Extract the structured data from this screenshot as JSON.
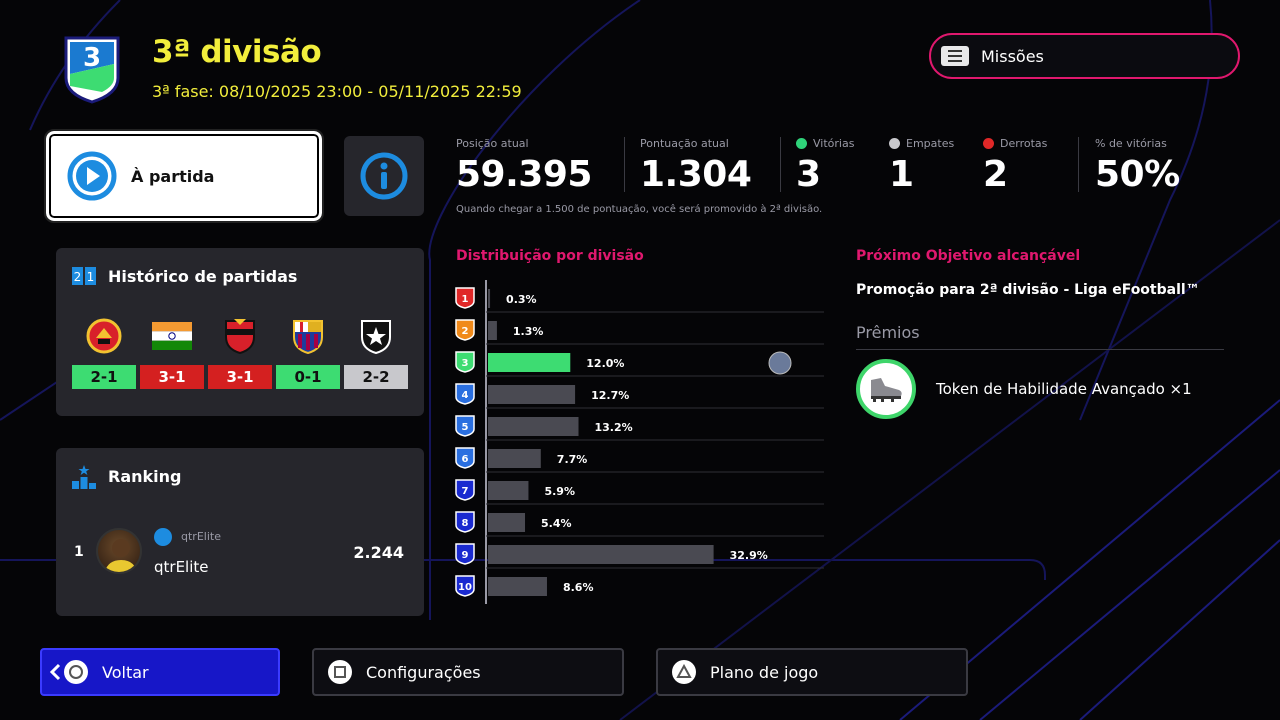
{
  "header": {
    "league_logo_text": "EFOOTBALL LEAGUE",
    "league_logo_number": "3",
    "title": "3ª divisão",
    "phase_dates": "3ª fase: 08/10/2025 23:00 - 05/11/2025 22:59",
    "missions_label": "Missões"
  },
  "match_button": {
    "label": "À partida"
  },
  "stats": {
    "position": {
      "label": "Posição atual",
      "value": "59.395"
    },
    "points": {
      "label": "Pontuação atual",
      "value": "1.304"
    },
    "wins": {
      "label": "Vitórias",
      "value": "3",
      "color": "#2fd37a"
    },
    "draws": {
      "label": "Empates",
      "value": "1",
      "color": "#c8c8cc"
    },
    "losses": {
      "label": "Derrotas",
      "value": "2",
      "color": "#e02828"
    },
    "win_pct": {
      "label": "% de vitórias",
      "value": "50%"
    },
    "note": "Quando chegar a 1.500 de pontuação, você será promovido à 2ª divisão."
  },
  "history": {
    "title": "Histórico de partidas",
    "matches": [
      {
        "opponent_icon": "manchester-united-crest-icon",
        "score": "2-1",
        "result": "win"
      },
      {
        "opponent_icon": "india-flag-icon",
        "score": "3-1",
        "result": "loss"
      },
      {
        "opponent_icon": "sport-recife-crest-icon",
        "score": "3-1",
        "result": "loss"
      },
      {
        "opponent_icon": "barcelona-crest-icon",
        "score": "0-1",
        "result": "win"
      },
      {
        "opponent_icon": "botafogo-crest-icon",
        "score": "2-2",
        "result": "draw"
      }
    ],
    "result_colors": {
      "win": "#3ddc72",
      "loss": "#d42020",
      "draw": "#c8c8cc"
    }
  },
  "ranking": {
    "title": "Ranking",
    "entries": [
      {
        "position": "1",
        "platform_name": "qtrElite",
        "name": "qtrElite",
        "points": "2.244"
      }
    ]
  },
  "distribution": {
    "title": "Distribuição por divisão",
    "current_division": "3"
  },
  "chart_data": {
    "type": "bar",
    "title": "Distribuição por divisão",
    "categories": [
      "1",
      "2",
      "3",
      "4",
      "5",
      "6",
      "7",
      "8",
      "9",
      "10"
    ],
    "values": [
      0.3,
      1.3,
      12.0,
      12.7,
      13.2,
      7.7,
      5.9,
      5.4,
      32.9,
      8.6
    ],
    "value_labels": [
      "0.3%",
      "1.3%",
      "12.0%",
      "12.7%",
      "13.2%",
      "7.7%",
      "5.9%",
      "5.4%",
      "32.9%",
      "8.6%"
    ],
    "badge_colors": [
      "#e02828",
      "#f08a1a",
      "#3ddc72",
      "#2a6fe0",
      "#2a6fe0",
      "#2a6fe0",
      "#1a2ad0",
      "#1a2ad0",
      "#1a2ad0",
      "#1a2ad0"
    ],
    "highlight_index": 2,
    "highlight_color": "#3ddc72",
    "bar_color": "#4a4a52",
    "orientation": "horizontal",
    "xlim": [
      0,
      35
    ]
  },
  "objective": {
    "title": "Próximo Objetivo alcançável",
    "text": "Promoção para 2ª divisão - Liga eFootball™",
    "prizes_label": "Prêmios",
    "prize_icon": "boot-icon",
    "prize_label": "Token de Habilidade Avançado ×1"
  },
  "footer": {
    "back_label": "Voltar",
    "settings_label": "Configurações",
    "plan_label": "Plano de jogo"
  }
}
